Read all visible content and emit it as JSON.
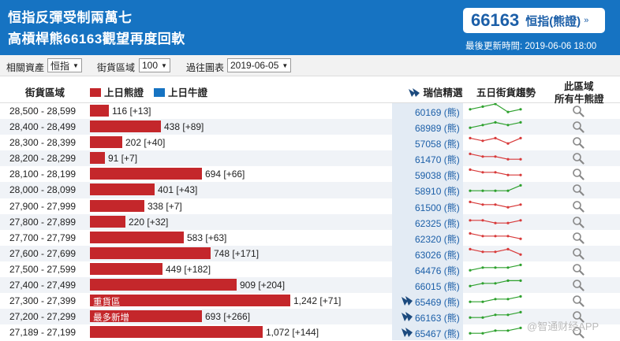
{
  "header": {
    "headline_line1": "恒指反彈受制兩萬七",
    "headline_line2": "高槓桿熊66163觀望再度回軟",
    "quote_value": "66163",
    "quote_name": "恒指(熊證)",
    "quote_arrow": "»",
    "updated": "最後更新時間: 2019-06-06 18:00"
  },
  "filters": {
    "asset_label": "相關資產",
    "asset_value": "恒指",
    "range_label": "街貨區域",
    "range_value": "100",
    "chart_label": "過往圖表",
    "chart_value": "2019-06-05"
  },
  "table_header": {
    "range": "街貨區域",
    "bear_legend": "上日熊證",
    "bull_legend": "上日牛證",
    "pick": "瑞信精選",
    "trend": "五日街貨趨勢",
    "all_line1": "此區域",
    "all_line2": "所有牛熊證"
  },
  "colors": {
    "bear": "#c4272b",
    "bull": "#1673c2",
    "trend_up": "#2ea12e",
    "trend_down": "#d83a3a"
  },
  "rows": [
    {
      "range": "28,500 - 28,599",
      "value": 116,
      "label": "116 [+13]",
      "tag": "",
      "code": "60169 (熊)",
      "icon": false,
      "trend": [
        3,
        4,
        5,
        2,
        3
      ],
      "dir": "up"
    },
    {
      "range": "28,400 - 28,499",
      "value": 438,
      "label": "438 [+89]",
      "tag": "",
      "code": "68989 (熊)",
      "icon": false,
      "trend": [
        2,
        3,
        4,
        3,
        4
      ],
      "dir": "up"
    },
    {
      "range": "28,300 - 28,399",
      "value": 202,
      "label": "202 [+40]",
      "tag": "",
      "code": "57058 (熊)",
      "icon": false,
      "trend": [
        4,
        3,
        4,
        2,
        4
      ],
      "dir": "down"
    },
    {
      "range": "28,200 - 28,299",
      "value": 91,
      "label": "91 [+7]",
      "tag": "",
      "code": "61470 (熊)",
      "icon": false,
      "trend": [
        4,
        3,
        3,
        2,
        2
      ],
      "dir": "down"
    },
    {
      "range": "28,100 - 28,199",
      "value": 694,
      "label": "694 [+66]",
      "tag": "",
      "code": "59038 (熊)",
      "icon": false,
      "trend": [
        4,
        3,
        3,
        2,
        2
      ],
      "dir": "down"
    },
    {
      "range": "28,000 - 28,099",
      "value": 401,
      "label": "401 [+43]",
      "tag": "",
      "code": "58910 (熊)",
      "icon": false,
      "trend": [
        2,
        2,
        2,
        2,
        4
      ],
      "dir": "up"
    },
    {
      "range": "27,900 - 27,999",
      "value": 338,
      "label": "338 [+7]",
      "tag": "",
      "code": "61500 (熊)",
      "icon": false,
      "trend": [
        4,
        3,
        3,
        2,
        3
      ],
      "dir": "down"
    },
    {
      "range": "27,800 - 27,899",
      "value": 220,
      "label": "220 [+32]",
      "tag": "",
      "code": "62325 (熊)",
      "icon": false,
      "trend": [
        3,
        3,
        2,
        2,
        3
      ],
      "dir": "down"
    },
    {
      "range": "27,700 - 27,799",
      "value": 583,
      "label": "583 [+63]",
      "tag": "",
      "code": "62320 (熊)",
      "icon": false,
      "trend": [
        4,
        3,
        3,
        3,
        2
      ],
      "dir": "down"
    },
    {
      "range": "27,600 - 27,699",
      "value": 748,
      "label": "748 [+171]",
      "tag": "",
      "code": "63026 (熊)",
      "icon": false,
      "trend": [
        4,
        3,
        3,
        4,
        2
      ],
      "dir": "down"
    },
    {
      "range": "27,500 - 27,599",
      "value": 449,
      "label": "449 [+182]",
      "tag": "",
      "code": "64476 (熊)",
      "icon": false,
      "trend": [
        2,
        3,
        3,
        3,
        4
      ],
      "dir": "up"
    },
    {
      "range": "27,400 - 27,499",
      "value": 909,
      "label": "909 [+204]",
      "tag": "",
      "code": "66015 (熊)",
      "icon": false,
      "trend": [
        2,
        3,
        3,
        4,
        4
      ],
      "dir": "up"
    },
    {
      "range": "27,300 - 27,399",
      "value": 1242,
      "label": "1,242 [+71]",
      "tag": "重貨區",
      "code": "65469 (熊)",
      "icon": true,
      "trend": [
        2,
        2,
        3,
        3,
        4
      ],
      "dir": "up"
    },
    {
      "range": "27,200 - 27,299",
      "value": 693,
      "label": "693 [+266]",
      "tag": "最多新增",
      "code": "66163 (熊)",
      "icon": true,
      "trend": [
        2,
        2,
        3,
        3,
        4
      ],
      "dir": "up"
    },
    {
      "range": "27,189 - 27,199",
      "value": 1072,
      "label": "1,072 [+144]",
      "tag": "",
      "code": "65467 (熊)",
      "icon": true,
      "trend": [
        2,
        2,
        3,
        3,
        4
      ],
      "dir": "up"
    }
  ],
  "watermark": "@智通财经APP"
}
